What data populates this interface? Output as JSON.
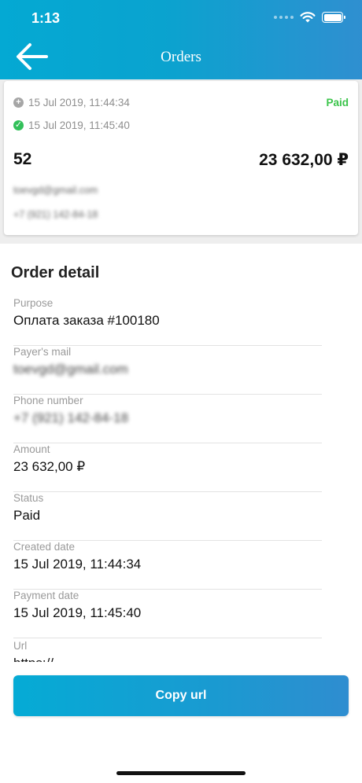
{
  "status_bar": {
    "time": "1:13"
  },
  "nav": {
    "title": "Orders",
    "back_icon": "arrow-left-icon"
  },
  "order_card": {
    "created": "15 Jul 2019, 11:44:34",
    "paid_at": "15 Jul 2019, 11:45:40",
    "status": "Paid",
    "number": "52",
    "amount": "23 632,00 ₽",
    "email": "toevgd@gmail.com",
    "phone": "+7 (921) 142-84-18",
    "colors": {
      "paid": "#3bc44b",
      "accent": "#0aa3cf"
    }
  },
  "detail": {
    "title": "Order detail",
    "fields": [
      {
        "label": "Purpose",
        "value": "Оплата заказа #100180"
      },
      {
        "label": "Payer's mail",
        "value": "toevgd@gmail.com"
      },
      {
        "label": "Phone number",
        "value": "+7 (921) 142-84-18"
      },
      {
        "label": "Amount",
        "value": "23 632,00 ₽"
      },
      {
        "label": "Status",
        "value": "Paid"
      },
      {
        "label": "Created date",
        "value": "15 Jul 2019, 11:44:34"
      },
      {
        "label": "Payment date",
        "value": "15 Jul 2019, 11:45:40"
      },
      {
        "label": "Url",
        "value": "https://..."
      }
    ]
  },
  "actions": {
    "copy_url": "Copy url"
  }
}
